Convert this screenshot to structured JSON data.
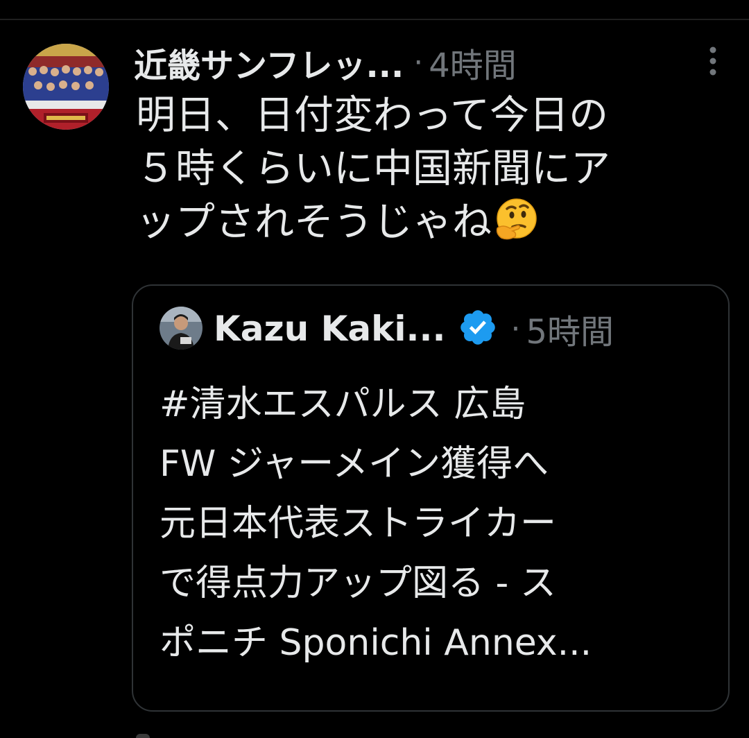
{
  "tweet": {
    "author_name": "近畿サンフレッ...",
    "separator": "·",
    "time": "4時間",
    "text": "明日、日付変わって今日の\n５時くらいに中国新聞にア\nップされそうじゃね",
    "emoji": "thinking-face-icon",
    "avatar": "team-photo-avatar",
    "more_icon": "more-options-icon"
  },
  "quote": {
    "author_name": "Kazu Kaki...",
    "verified_icon": "verified-badge-icon",
    "separator": "·",
    "time": "5時間",
    "text": "#清水エスパルス 広島\nFW ジャーメイン獲得へ\n元日本代表ストライカー\nで得点力アップ図る - ス\nポニチ Sponichi Annex..."
  },
  "colors": {
    "background": "#000000",
    "text_primary": "#e7e9ea",
    "text_secondary": "#71767b",
    "border": "#2f3336",
    "verified_blue": "#1d9bf0"
  }
}
